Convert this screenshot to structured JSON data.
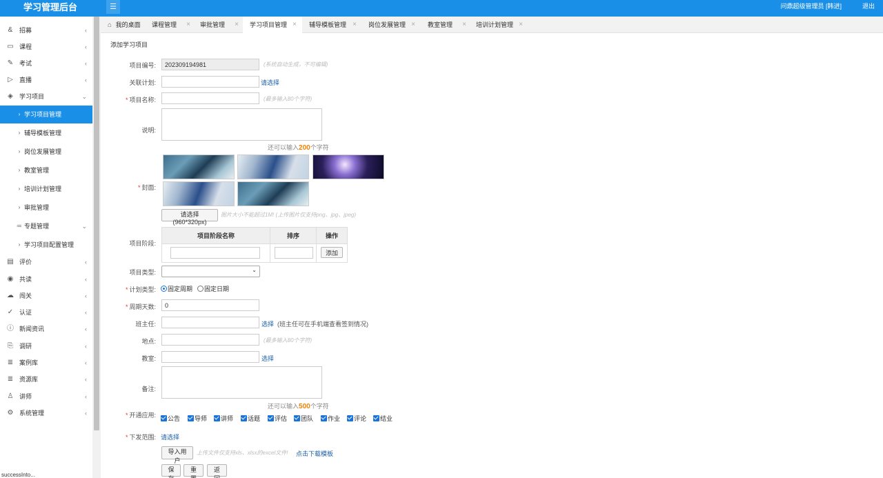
{
  "header": {
    "brand": "学习管理后台",
    "menu_icon": "☰",
    "user": "问鼎超级管理员 [韩进]",
    "logout": "退出"
  },
  "sidebar": {
    "items": [
      {
        "icon": "&",
        "label": "招募",
        "arrow": "‹"
      },
      {
        "icon": "▭",
        "label": "课程",
        "arrow": "‹"
      },
      {
        "icon": "✎",
        "label": "考试",
        "arrow": "‹"
      },
      {
        "icon": "▷",
        "label": "直播",
        "arrow": "‹"
      },
      {
        "icon": "◈",
        "label": "学习项目",
        "arrow": "⌄"
      },
      {
        "icon": "▤",
        "label": "评价",
        "arrow": "‹"
      },
      {
        "icon": "◉",
        "label": "共读",
        "arrow": "‹"
      },
      {
        "icon": "☁",
        "label": "闯关",
        "arrow": "‹"
      },
      {
        "icon": "✓",
        "label": "认证",
        "arrow": "‹"
      },
      {
        "icon": "ⓘ",
        "label": "新闻资讯",
        "arrow": "‹"
      },
      {
        "icon": "⎘",
        "label": "调研",
        "arrow": "‹"
      },
      {
        "icon": "≣",
        "label": "案例库",
        "arrow": "‹"
      },
      {
        "icon": "≣",
        "label": "资源库",
        "arrow": "‹"
      },
      {
        "icon": "♙",
        "label": "讲师",
        "arrow": "‹"
      },
      {
        "icon": "⚙",
        "label": "系统管理",
        "arrow": "‹"
      }
    ],
    "sub_items": [
      {
        "icon": "›",
        "label": "学习项目管理"
      },
      {
        "icon": "›",
        "label": "辅导模板管理"
      },
      {
        "icon": "›",
        "label": "岗位发展管理"
      },
      {
        "icon": "›",
        "label": "教室管理"
      },
      {
        "icon": "›",
        "label": "培训计划管理"
      },
      {
        "icon": "›",
        "label": "审批管理"
      },
      {
        "icon": "≔",
        "label": "专题管理",
        "arrow": "⌄"
      },
      {
        "icon": "›",
        "label": "学习项目配置管理"
      }
    ],
    "bottom_text": "successInto..."
  },
  "tabs": [
    {
      "label": "我的桌面",
      "icon": "⌂"
    },
    {
      "label": "课程管理",
      "close": "×"
    },
    {
      "label": "审批管理",
      "close": "×"
    },
    {
      "label": "学习项目管理",
      "close": "×"
    },
    {
      "label": "辅导模板管理",
      "close": "×"
    },
    {
      "label": "岗位发展管理",
      "close": "×"
    },
    {
      "label": "教室管理",
      "close": "×"
    },
    {
      "label": "培训计划管理",
      "close": "×"
    }
  ],
  "form": {
    "title": "添加学习项目",
    "req_mark": "*",
    "project_no": {
      "label": "项目编号:",
      "value": "202309194981",
      "hint": "(系统自动生成，不可编辑)"
    },
    "related_plan": {
      "label": "关联计划:",
      "value": "",
      "link": "请选择"
    },
    "project_name": {
      "label": "项目名称:",
      "value": "",
      "hint": "(最多输入80个字符)"
    },
    "description": {
      "label": "说明:",
      "counter_prefix": "还可以输入",
      "counter_value": "200",
      "counter_suffix": "个字符"
    },
    "cover": {
      "label": "封面:",
      "button": "请选择(960*320px)",
      "hint": "图片大小不能超过1M! (上传图片仅支持png、jpg、jpeg)"
    },
    "stages": {
      "label": "项目阶段:",
      "col_name": "项目阶段名称",
      "col_order": "排序",
      "col_action": "操作",
      "add_button": "添加"
    },
    "project_type": {
      "label": "项目类型:",
      "value": "",
      "caret": "⌄"
    },
    "plan_type": {
      "label": "计划类型:",
      "option1": "固定周期",
      "option2": "固定日期"
    },
    "cycle_days": {
      "label": "周期天数:",
      "value": "0"
    },
    "head_teacher": {
      "label": "班主任:",
      "link": "选择",
      "note": "(班主任可在手机端查看签到情况)"
    },
    "location": {
      "label": "地点:",
      "hint": "(最多输入80个字符)"
    },
    "classroom": {
      "label": "教室:",
      "link": "选择"
    },
    "remarks": {
      "label": "备注:",
      "counter_prefix": "还可以输入",
      "counter_value": "500",
      "counter_suffix": "个字符"
    },
    "apps": {
      "label": "开通应用:",
      "options": [
        "公告",
        "导师",
        "讲师",
        "话题",
        "评估",
        "团队",
        "作业",
        "评论",
        "结业"
      ]
    },
    "scope": {
      "label": "下发范围:",
      "link": "请选择"
    },
    "import": {
      "button": "导入用户",
      "hint": "上传文件仅支持xls、xlsx的excel文件!",
      "link": "点击下载模板"
    },
    "actions": {
      "save": "保存",
      "reset": "重置",
      "back": "返回"
    }
  }
}
